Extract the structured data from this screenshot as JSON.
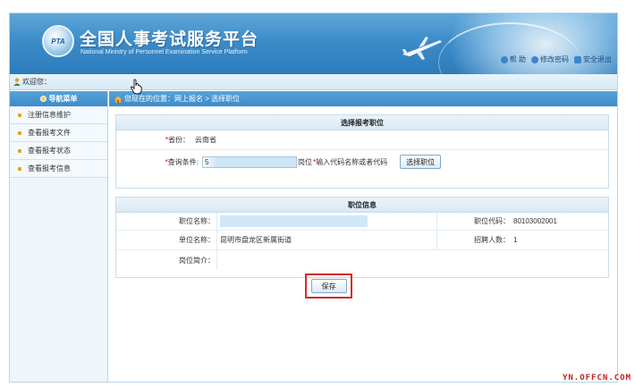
{
  "header": {
    "logo_text": "PTA",
    "title": "全国人事考试服务平台",
    "subtitle": "National Ministry of Personnel Examination Service Platform",
    "links": [
      {
        "label": "帮 助",
        "icon": "help-icon",
        "color": "#3a86c8"
      },
      {
        "label": "修改密码",
        "icon": "key-icon",
        "color": "#3a86c8"
      },
      {
        "label": "安全退出",
        "icon": "exit-icon",
        "color": "#3a86c8"
      }
    ]
  },
  "welcome": {
    "text": "欢迎您："
  },
  "sidebar": {
    "title": "导航菜单",
    "items": [
      {
        "label": "注册信息维护"
      },
      {
        "label": "查看报考文件"
      },
      {
        "label": "查看报考状态"
      },
      {
        "label": "查看报考信息"
      }
    ]
  },
  "breadcrumb": {
    "text": "您现在的位置：网上报名 > 选择职位"
  },
  "select_panel": {
    "title": "选择报考职位",
    "province_label": "省份：",
    "province_value": "云南省",
    "condition_label": "查询条件:",
    "condition_value": "5",
    "post_suffix": "岗位",
    "hint": "输入代码名称或者代码",
    "select_button": "选择职位"
  },
  "info_panel": {
    "title": "职位信息",
    "position_name_label": "职位名称：",
    "position_name_value": "",
    "position_code_label": "职位代码：",
    "position_code_value": "80103002001",
    "unit_name_label": "单位名称：",
    "unit_name_value": "昆明市盘龙区新属街道",
    "recruit_count_label": "招聘人数：",
    "recruit_count_value": "1",
    "position_intro_label": "岗位简介：",
    "position_intro_value": ""
  },
  "actions": {
    "save_label": "保存"
  },
  "watermark": "YN.OFFCN.COM",
  "colors": {
    "header_blue": "#3c8cc9",
    "highlight_red": "#d62b2b",
    "watermark_red": "#c21f1f",
    "mask_blue": "#cfe8f7"
  }
}
